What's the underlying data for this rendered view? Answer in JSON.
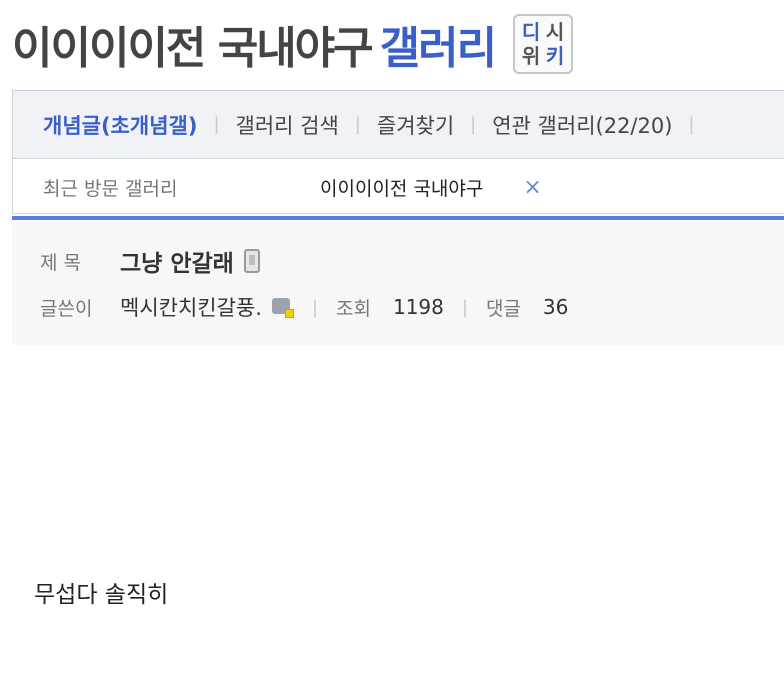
{
  "header": {
    "gallery_name": "이이이이전 국내야구",
    "gallery_suffix": "갤러리",
    "wiki_badge": [
      "디",
      "시",
      "위",
      "키"
    ]
  },
  "tabs": [
    {
      "label": "개념글(초개념갤)",
      "active": true
    },
    {
      "label": "갤러리 검색",
      "active": false
    },
    {
      "label": "즐겨찾기",
      "active": false
    },
    {
      "label": "연관 갤러리(22/20)",
      "active": false
    }
  ],
  "recent": {
    "label": "최근 방문 갤러리",
    "item": "이이이이전 국내야구",
    "close_icon": "×"
  },
  "post": {
    "title_label": "제 목",
    "title": "그냥 안갈래",
    "author_label": "글쓴이",
    "author": "멕시칸치킨갈풍.",
    "views_label": "조회",
    "views": "1198",
    "comments_label": "댓글",
    "comments": "36",
    "body": "무섭다 솔직히"
  },
  "colors": {
    "accent": "#3b5fc9",
    "rule": "#5b7fd9"
  }
}
